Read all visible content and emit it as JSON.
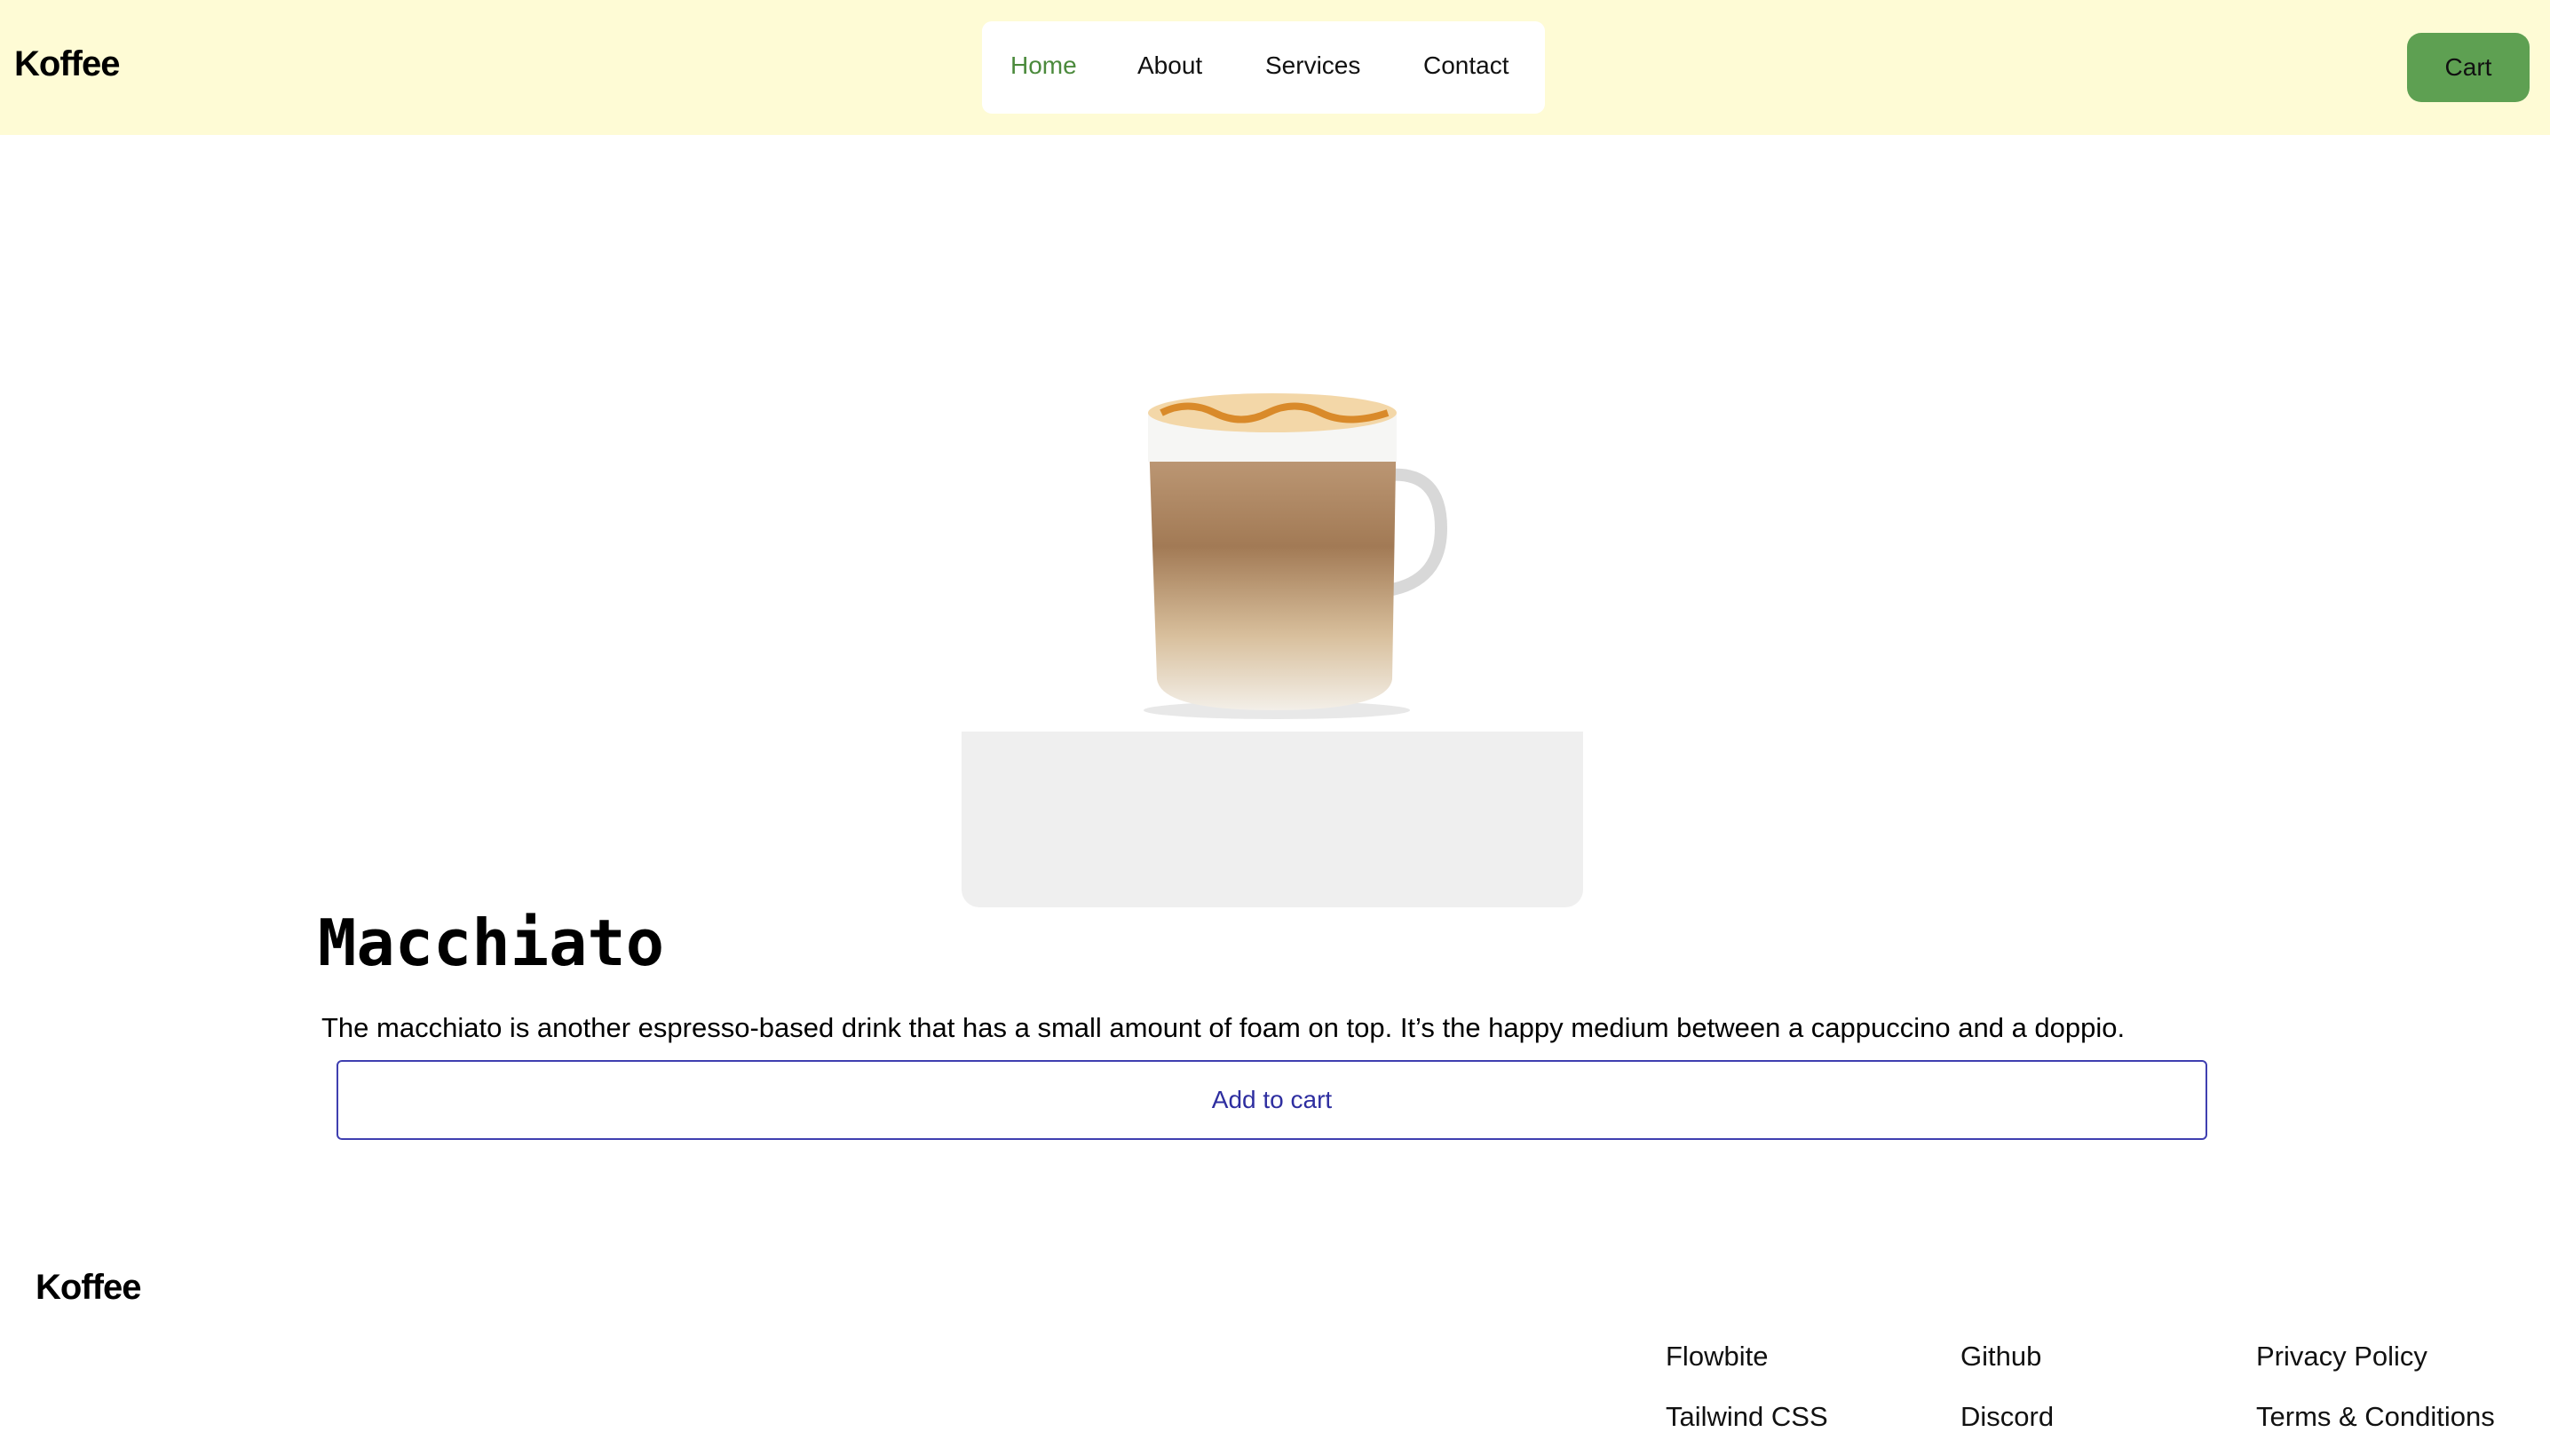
{
  "header": {
    "logo": "Koffee",
    "nav": [
      "Home",
      "About",
      "Services",
      "Contact"
    ],
    "cart": "Cart"
  },
  "product": {
    "title": "Macchiato",
    "description": "The macchiato is another espresso-based drink that has a small amount of foam on top. It’s the happy medium between a cappuccino and a doppio.",
    "add_to_cart": "Add to cart"
  },
  "footer": {
    "logo": "Koffee",
    "links": [
      "Flowbite",
      "Tailwind CSS",
      "Github",
      "Discord",
      "Privacy Policy",
      "Terms & Conditions"
    ]
  },
  "colors": {
    "header_bg": "#fefbd5",
    "accent": "#5ea052",
    "button_border": "#3f3fb0"
  }
}
